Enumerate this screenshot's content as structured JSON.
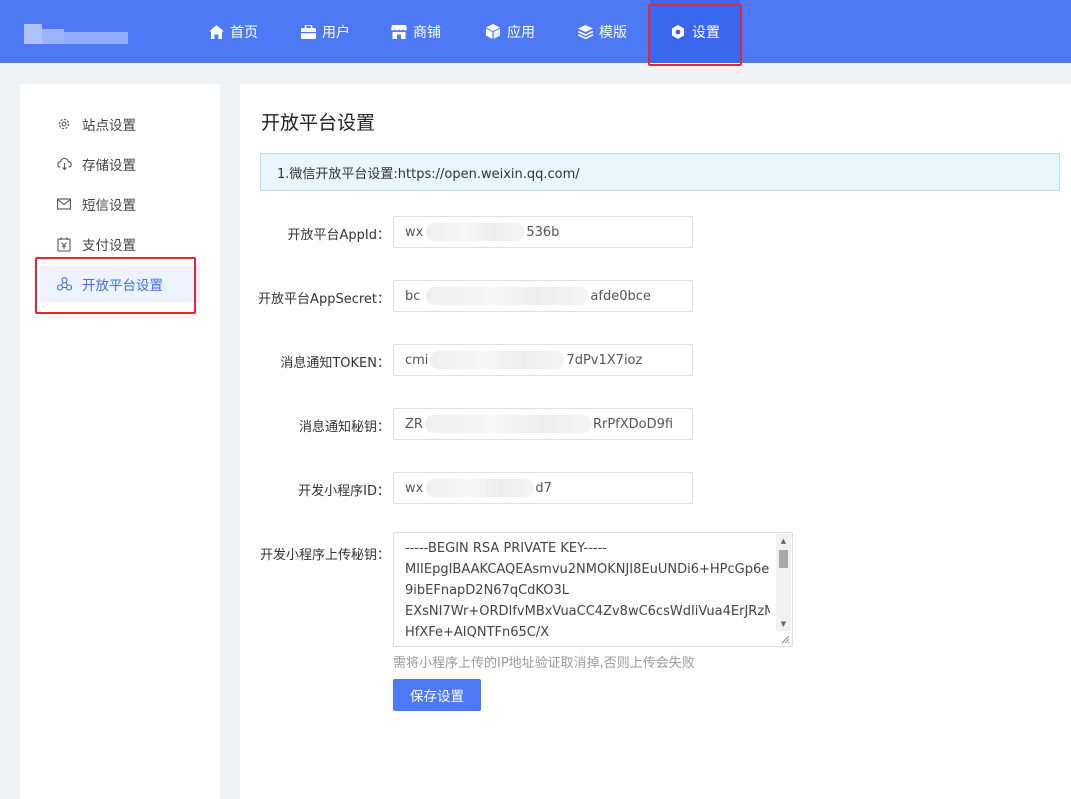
{
  "nav": {
    "items": [
      {
        "label": "首页",
        "icon": "home-icon"
      },
      {
        "label": "用户",
        "icon": "briefcase-icon"
      },
      {
        "label": "商铺",
        "icon": "store-icon"
      },
      {
        "label": "应用",
        "icon": "cube-icon"
      },
      {
        "label": "模版",
        "icon": "layers-icon"
      },
      {
        "label": "设置",
        "icon": "settings-icon",
        "active": true
      }
    ]
  },
  "sidebar": {
    "items": [
      {
        "label": "站点设置",
        "icon": "gear-icon"
      },
      {
        "label": "存储设置",
        "icon": "cloud-download-icon"
      },
      {
        "label": "短信设置",
        "icon": "mail-icon"
      },
      {
        "label": "支付设置",
        "icon": "payment-icon"
      },
      {
        "label": "开放平台设置",
        "icon": "share-nodes-icon",
        "active": true
      }
    ]
  },
  "page": {
    "title": "开放平台设置",
    "notice": "1.微信开放平台设置:https://open.weixin.qq.com/"
  },
  "form": {
    "appid": {
      "label": "开放平台AppId：",
      "prefix": "wx",
      "suffix": "536b"
    },
    "appsecret": {
      "label": "开放平台AppSecret：",
      "prefix": "bc",
      "suffix": "afde0bce"
    },
    "token": {
      "label": "消息通知TOKEN：",
      "prefix": "cmi",
      "suffix": "7dPv1X7ioz"
    },
    "aeskey": {
      "label": "消息通知秘钥：",
      "prefix": "ZR",
      "suffix": "RrPfXDoD9fi"
    },
    "miniapp_id": {
      "label": "开发小程序ID：",
      "prefix": "wx",
      "suffix": "d7"
    },
    "upload_key": {
      "label": "开发小程序上传秘钥：",
      "lines": [
        "-----BEGIN RSA PRIVATE KEY-----",
        "MIIEpgIBAAKCAQEAsmvu2NMOKNJI8EuUNDi6+HPcGp6e",
        "9ibEFnapD2N67qCdKO3L",
        "EXsNI7Wr+ORDIfvMBxVuaCC4Zv8wC6csWdIiVua4ErJRzM",
        "HfXFe+AIQNTFn65C/X"
      ]
    },
    "hint": "需将小程序上传的IP地址验证取消掉,否则上传会失败",
    "save_label": "保存设置"
  },
  "colors": {
    "primary": "#4e79f6",
    "highlight": "#e8262e",
    "info_bg": "#e9f7fc"
  }
}
